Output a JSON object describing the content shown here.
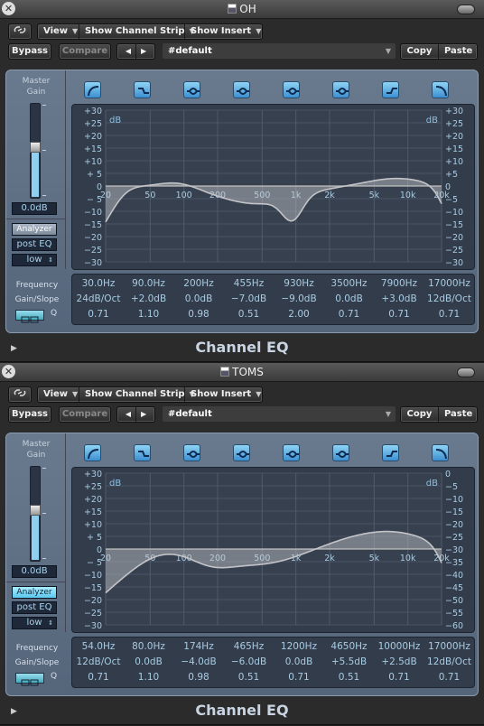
{
  "colors": {
    "accent": "#8fd0f0",
    "panel": "#5f6f84",
    "graph_bg": "#333c4a",
    "value_text": "#a8cce4"
  },
  "windows": [
    {
      "title": "OH",
      "toolbar": {
        "link_icon": "link-icon",
        "view": "View",
        "show_channel_strip": "Show Channel Strip",
        "show_insert": "Show Insert"
      },
      "header": {
        "bypass": "Bypass",
        "compare": "Compare",
        "prev": "◀",
        "next": "▶",
        "preset": "#default",
        "copy": "Copy",
        "paste": "Paste"
      },
      "master_gain": {
        "label": "Master Gain",
        "value": "0.0dB",
        "level_db": 0
      },
      "analyzer": {
        "label": "Analyzer",
        "active": false,
        "mode": "post EQ",
        "resolution": "low"
      },
      "bands": [
        "low-cut",
        "low-shelf",
        "bell",
        "bell",
        "bell",
        "bell",
        "high-shelf",
        "high-cut"
      ],
      "param_labels": {
        "frequency": "Frequency",
        "gain": "Gain/Slope",
        "q": "Q"
      },
      "params": [
        {
          "freq": "30.0Hz",
          "gain": "24dB/Oct",
          "q": "0.71"
        },
        {
          "freq": "90.0Hz",
          "gain": "+2.0dB",
          "q": "1.10"
        },
        {
          "freq": "200Hz",
          "gain": "0.0dB",
          "q": "0.98"
        },
        {
          "freq": "455Hz",
          "gain": "−7.0dB",
          "q": "0.51"
        },
        {
          "freq": "930Hz",
          "gain": "−9.0dB",
          "q": "2.00"
        },
        {
          "freq": "3500Hz",
          "gain": "0.0dB",
          "q": "0.71"
        },
        {
          "freq": "7900Hz",
          "gain": "+3.0dB",
          "q": "0.71"
        },
        {
          "freq": "17000Hz",
          "gain": "12dB/Oct",
          "q": "0.71"
        }
      ],
      "graph": {
        "unit": "dB",
        "left_ticks": [
          "+30",
          "+25",
          "+20",
          "+15",
          "+10",
          "+ 5",
          "0",
          "− 5",
          "−10",
          "−15",
          "−20",
          "−25",
          "−30"
        ],
        "right_ticks": [
          "+30",
          "+25",
          "+20",
          "+15",
          "+10",
          "+5",
          "0",
          "−5",
          "−10",
          "−15",
          "−20",
          "−25",
          "−30"
        ],
        "freq_ticks": [
          "20",
          "50",
          "100",
          "200",
          "500",
          "1k",
          "2k",
          "5k",
          "10k",
          "20k"
        ]
      },
      "footer": "Channel EQ"
    },
    {
      "title": "TOMS",
      "toolbar": {
        "link_icon": "link-icon",
        "view": "View",
        "show_channel_strip": "Show Channel Strip",
        "show_insert": "Show Insert"
      },
      "header": {
        "bypass": "Bypass",
        "compare": "Compare",
        "prev": "◀",
        "next": "▶",
        "preset": "#default",
        "copy": "Copy",
        "paste": "Paste"
      },
      "master_gain": {
        "label": "Master Gain",
        "value": "0.0dB",
        "level_db": 0
      },
      "analyzer": {
        "label": "Analyzer",
        "active": true,
        "mode": "post EQ",
        "resolution": "low"
      },
      "bands": [
        "low-cut",
        "low-shelf",
        "bell",
        "bell",
        "bell",
        "bell",
        "high-shelf",
        "high-cut"
      ],
      "param_labels": {
        "frequency": "Frequency",
        "gain": "Gain/Slope",
        "q": "Q"
      },
      "params": [
        {
          "freq": "54.0Hz",
          "gain": "12dB/Oct",
          "q": "0.71"
        },
        {
          "freq": "80.0Hz",
          "gain": "0.0dB",
          "q": "1.10"
        },
        {
          "freq": "174Hz",
          "gain": "−4.0dB",
          "q": "0.98"
        },
        {
          "freq": "465Hz",
          "gain": "−6.0dB",
          "q": "0.51"
        },
        {
          "freq": "1200Hz",
          "gain": "0.0dB",
          "q": "0.71"
        },
        {
          "freq": "4650Hz",
          "gain": "+5.5dB",
          "q": "0.51"
        },
        {
          "freq": "10000Hz",
          "gain": "+2.5dB",
          "q": "0.71"
        },
        {
          "freq": "17000Hz",
          "gain": "12dB/Oct",
          "q": "0.71"
        }
      ],
      "graph": {
        "unit": "dB",
        "left_ticks": [
          "+30",
          "+25",
          "+20",
          "+15",
          "+10",
          "+ 5",
          "0",
          "− 5",
          "−10",
          "−15",
          "−20",
          "−25",
          "−30"
        ],
        "right_ticks": [
          "0",
          "−5",
          "−10",
          "−15",
          "−20",
          "−25",
          "−30",
          "−35",
          "−40",
          "−45",
          "−50",
          "−55",
          "−60"
        ],
        "freq_ticks": [
          "20",
          "50",
          "100",
          "200",
          "500",
          "1k",
          "2k",
          "5k",
          "10k",
          "20k"
        ]
      },
      "footer": "Channel EQ"
    }
  ]
}
